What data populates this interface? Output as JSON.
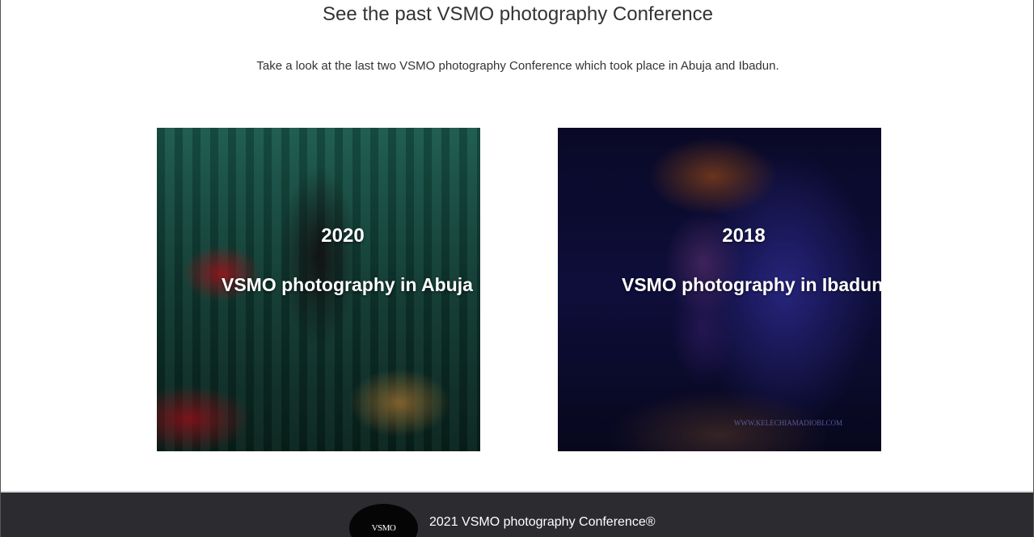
{
  "section": {
    "heading": "See the past VSMO photography Conference",
    "subtext": "Take a look at the last two VSMO photography Conference which took place in Abuja and Ibadun."
  },
  "cards": [
    {
      "year": "2020",
      "title": "VSMO photography in Abuja",
      "image": "photo-abuja"
    },
    {
      "year": "2018",
      "title": "VSMO photography in Ibadun",
      "image": "photo-ibadun",
      "watermark": "WWW.KELECHIAMADIOBI.COM"
    }
  ],
  "footer": {
    "logo_text": "VSMO",
    "copyright": "2021 VSMO photography Conference®"
  }
}
